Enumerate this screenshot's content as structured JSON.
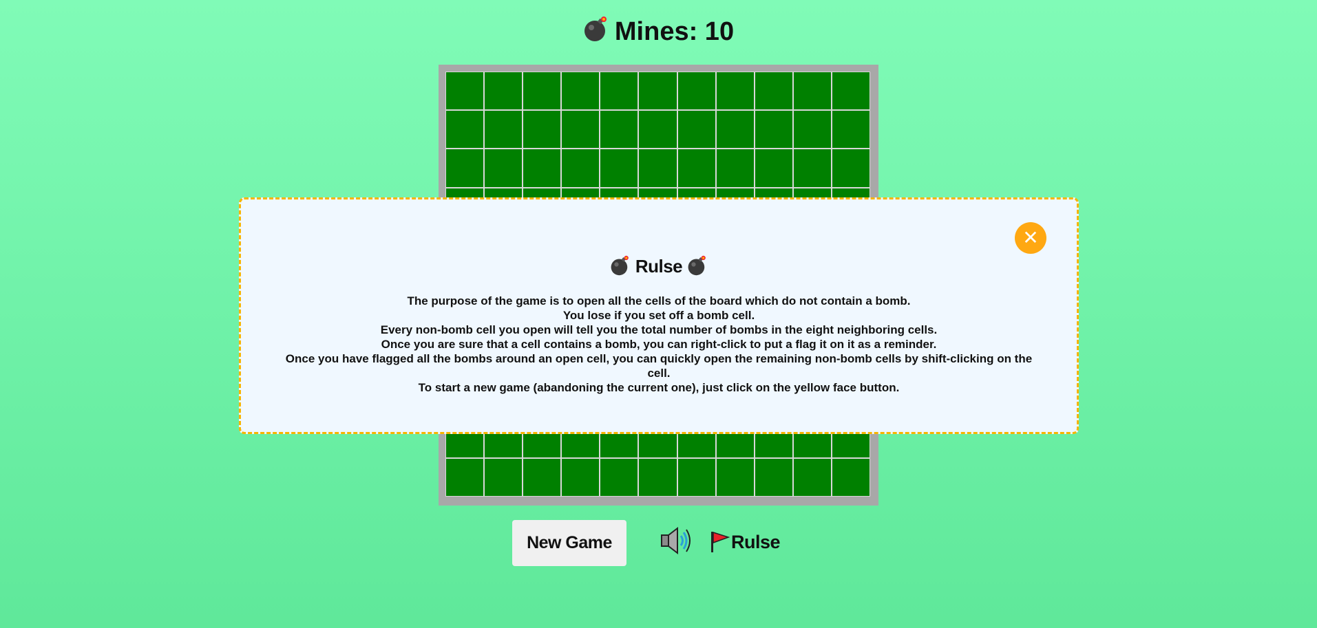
{
  "header": {
    "icon": "bomb-icon",
    "label": "Mines: 10"
  },
  "board": {
    "rows": 11,
    "cols": 11,
    "cell_color": "#008000",
    "frame_color": "#a8a8a8"
  },
  "modal": {
    "title": "Rulse",
    "close_label": "✕",
    "rules": [
      "The purpose of the game is to open all the cells of the board which do not contain a bomb.",
      "You lose if you set off a bomb cell.",
      "Every non-bomb cell you open will tell you the total number of bombs in the eight neighboring cells.",
      "Once you are sure that a cell contains a bomb, you can right-click to put a flag it on it as a reminder.",
      "Once you have flagged all the bombs around an open cell, you can quickly open the remaining non-bomb cells by shift-clicking on the cell.",
      "To start a new game (abandoning the current one), just click on the yellow face button."
    ],
    "border_color": "#f7b500",
    "close_color": "#ffa812"
  },
  "controls": {
    "new_game_label": "New Game",
    "sound_icon": "speaker-icon",
    "rules_label": "Rulse",
    "rules_icon": "flag-icon"
  }
}
